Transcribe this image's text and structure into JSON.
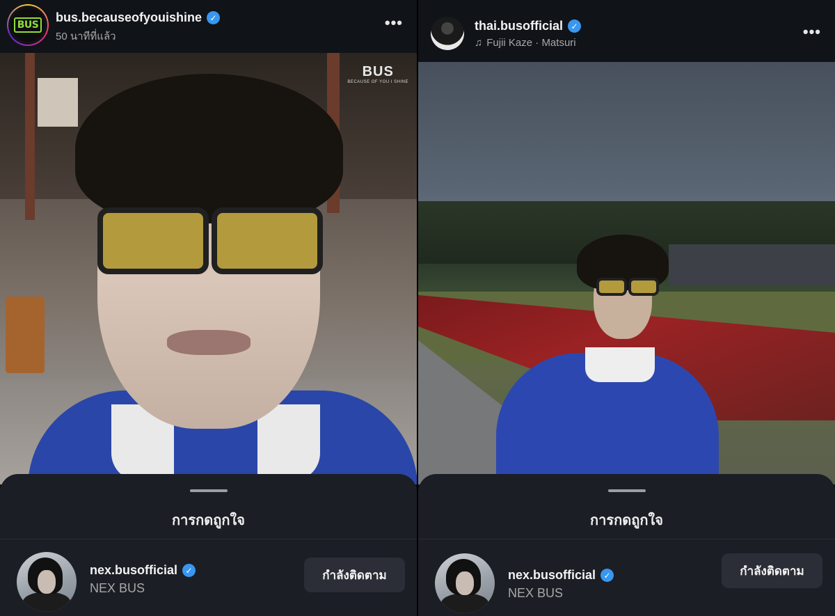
{
  "left_post": {
    "username": "bus.becauseofyouishine",
    "timestamp": "50 นาทีที่แล้ว",
    "avatar_logo": "BUS",
    "watermark_main": "BUS",
    "watermark_sub": "BECAUSE OF YOU I SHINE",
    "more_label": "•••",
    "sheet": {
      "title": "การกดถูกใจ",
      "user": {
        "username": "nex.busofficial",
        "full_name": "NEX BUS",
        "button": "กำลังติดตาม"
      }
    }
  },
  "right_post": {
    "username": "thai.busofficial",
    "music": "Fujii Kaze · Matsuri",
    "music_icon": "♫",
    "more_label": "•••",
    "sheet": {
      "title": "การกดถูกใจ",
      "user": {
        "username": "nex.busofficial",
        "full_name": "NEX BUS",
        "button": "กำลังติดตาม"
      }
    }
  },
  "icons": {
    "verified": "✓"
  },
  "colors": {
    "background": "#101318",
    "sheet": "#1b1e25",
    "verified": "#3897f0",
    "button": "#2b2e36"
  }
}
